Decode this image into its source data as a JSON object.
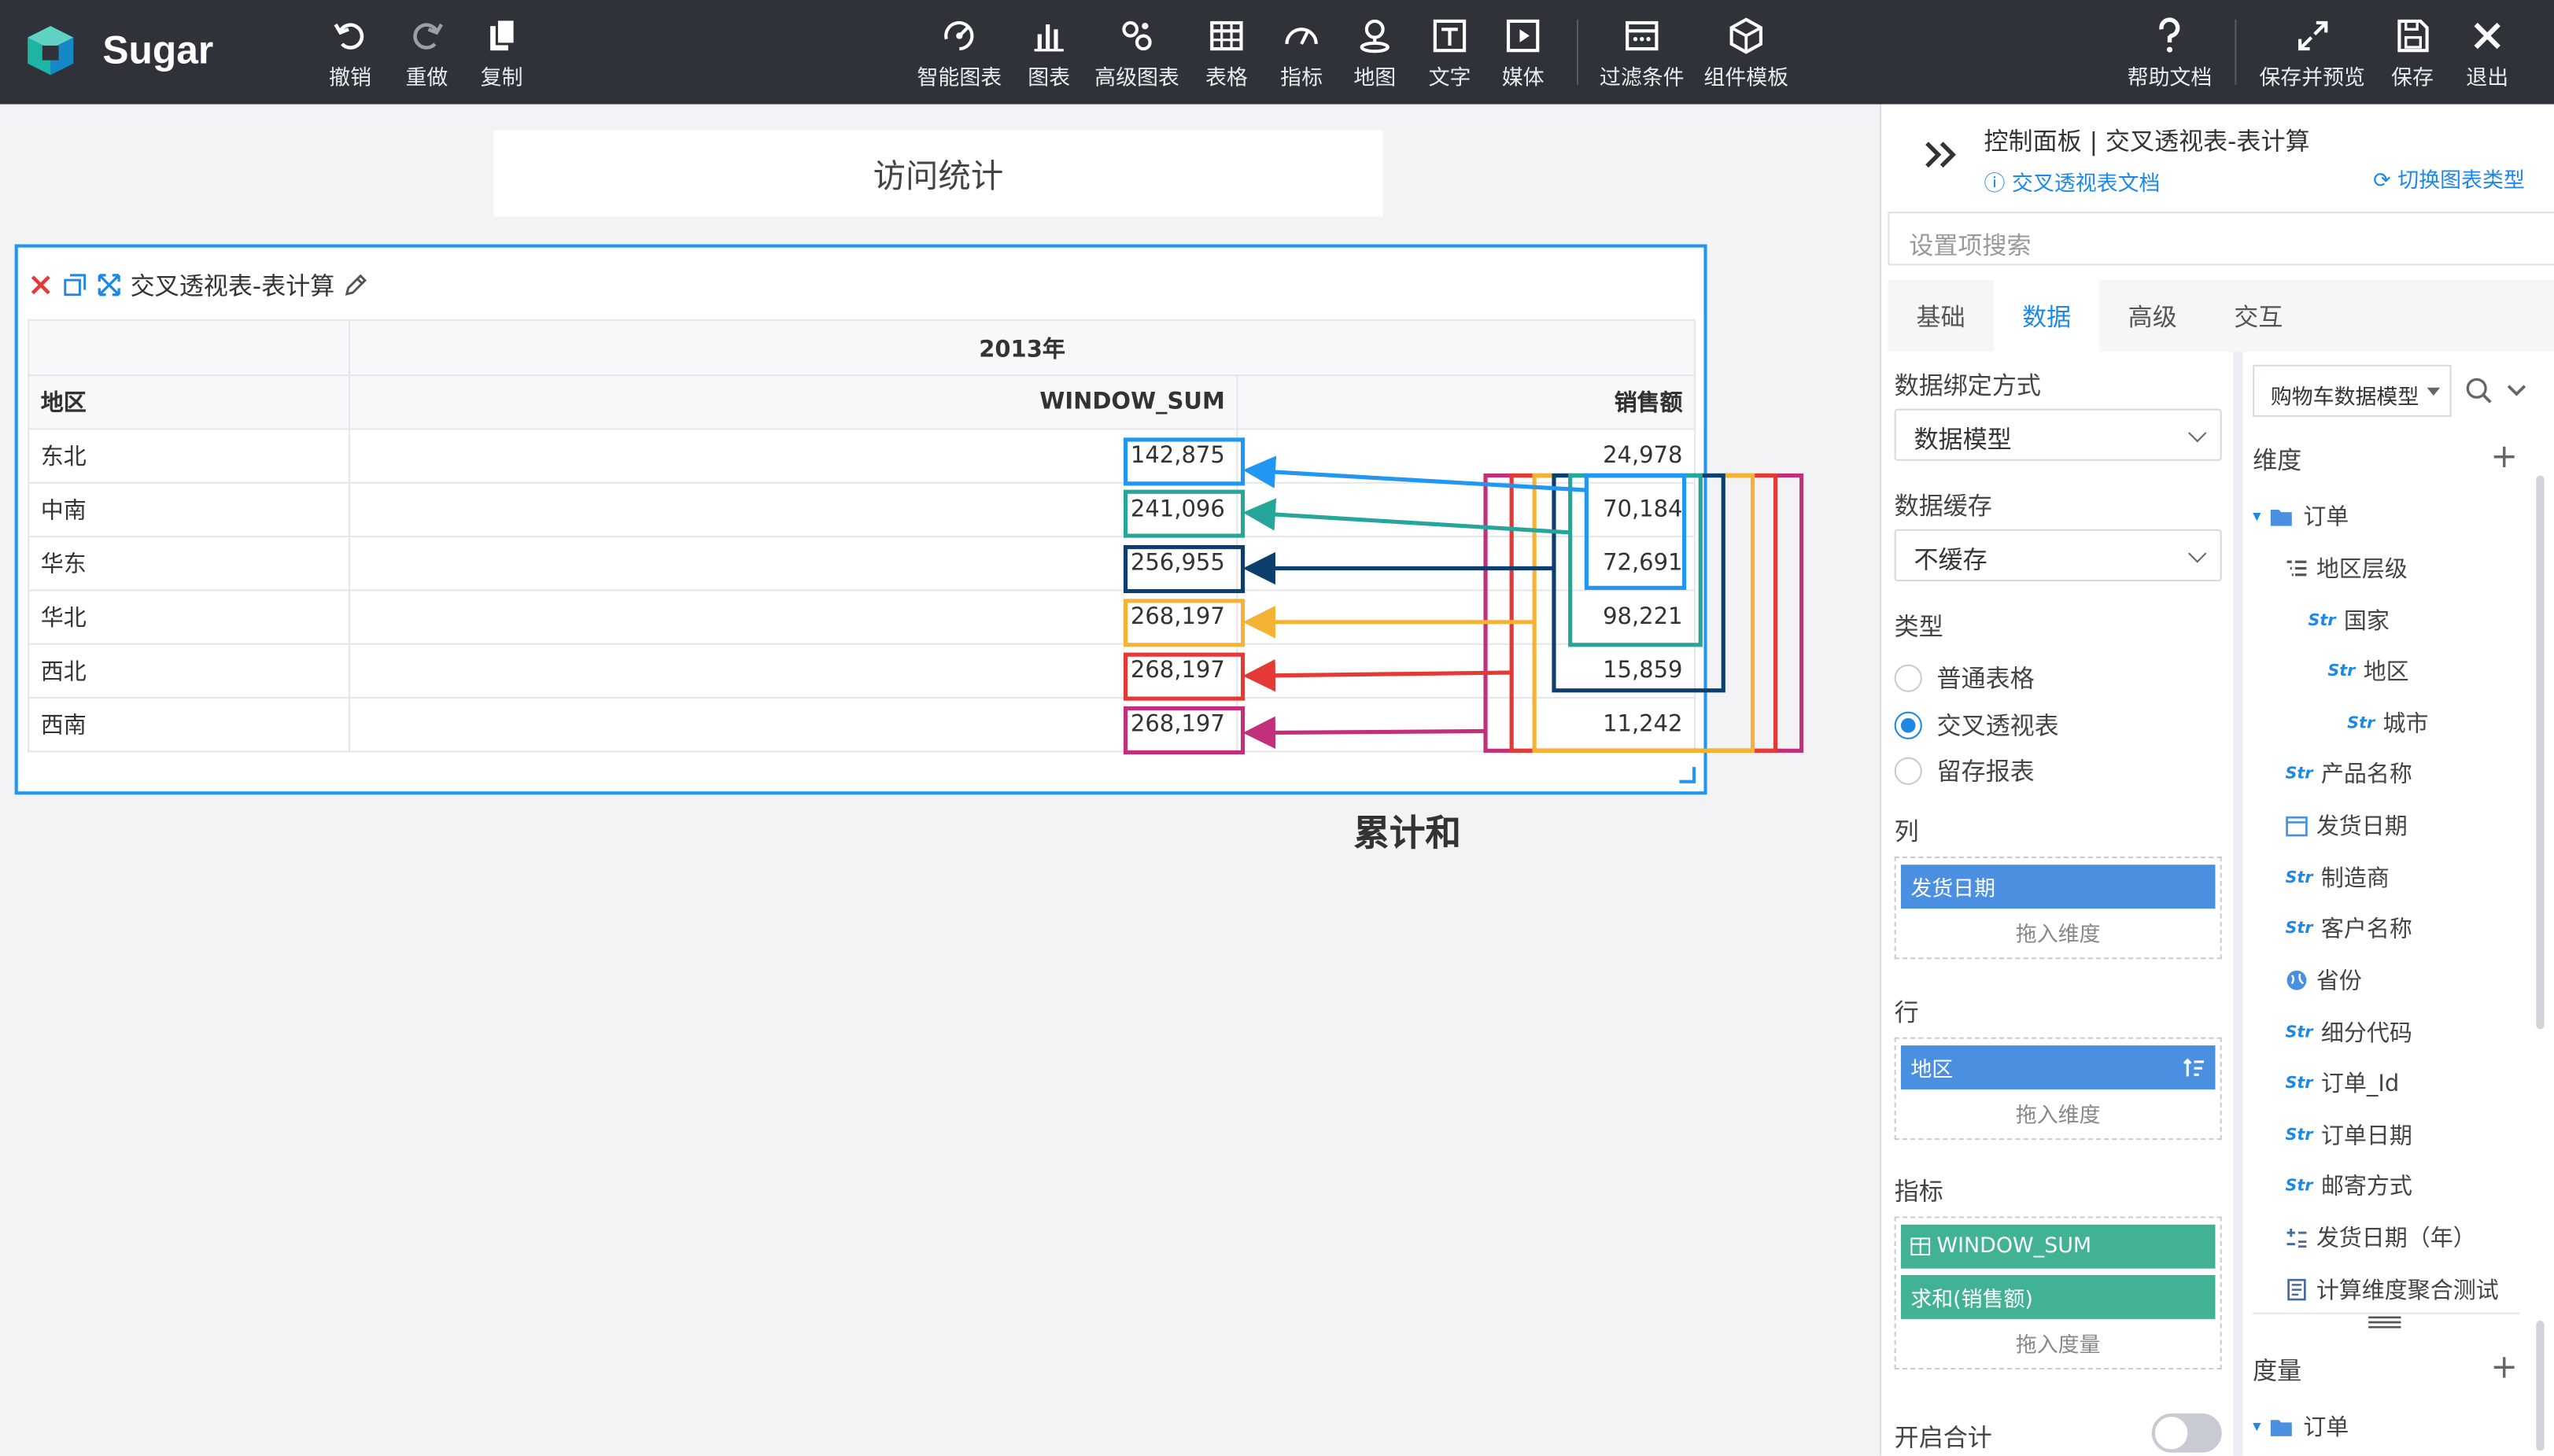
{
  "app": {
    "name": "Sugar"
  },
  "toolbar": {
    "left": [
      {
        "label": "撤销",
        "icon": "undo-icon"
      },
      {
        "label": "重做",
        "icon": "redo-icon"
      },
      {
        "label": "复制",
        "icon": "copy-icon"
      }
    ],
    "center": [
      {
        "label": "智能图表",
        "icon": "smart-chart-icon"
      },
      {
        "label": "图表",
        "icon": "bar-chart-icon"
      },
      {
        "label": "高级图表",
        "icon": "advanced-chart-icon"
      },
      {
        "label": "表格",
        "icon": "table-icon"
      },
      {
        "label": "指标",
        "icon": "gauge-icon"
      },
      {
        "label": "地图",
        "icon": "map-pin-icon"
      },
      {
        "label": "文字",
        "icon": "text-icon"
      },
      {
        "label": "媒体",
        "icon": "media-icon"
      },
      {
        "label": "过滤条件",
        "icon": "filter-icon"
      },
      {
        "label": "组件模板",
        "icon": "template-icon"
      }
    ],
    "right": [
      {
        "label": "帮助文档",
        "icon": "help-icon"
      },
      {
        "label": "保存并预览",
        "icon": "expand-icon"
      },
      {
        "label": "保存",
        "icon": "save-icon"
      },
      {
        "label": "退出",
        "icon": "close-icon"
      }
    ]
  },
  "canvas": {
    "page_title": "访问统计",
    "widget": {
      "title": "交叉透视表-表计算",
      "column_group": "2013年",
      "row_header": "地区",
      "col_headers": [
        "WINDOW_SUM",
        "销售额"
      ],
      "rows": [
        {
          "region": "东北",
          "window_sum": "142,875",
          "sales": "24,978"
        },
        {
          "region": "中南",
          "window_sum": "241,096",
          "sales": "70,184"
        },
        {
          "region": "华东",
          "window_sum": "256,955",
          "sales": "72,691"
        },
        {
          "region": "华北",
          "window_sum": "268,197",
          "sales": "98,221"
        },
        {
          "region": "西北",
          "window_sum": "268,197",
          "sales": "15,859"
        },
        {
          "region": "西南",
          "window_sum": "268,197",
          "sales": "11,242"
        }
      ]
    },
    "annotation": {
      "label": "累计和",
      "colors": [
        "#2196f3",
        "#26a69a",
        "#0d3f6e",
        "#f5b335",
        "#e53935",
        "#c2307a"
      ]
    }
  },
  "panel": {
    "title": "控制面板 | 交叉透视表-表计算",
    "doc_link": "交叉透视表文档",
    "switch_link": "切换图表类型",
    "search_placeholder": "设置项搜索",
    "tabs": [
      "基础",
      "数据",
      "高级",
      "交互"
    ],
    "active_tab": "数据",
    "binding_label": "数据绑定方式",
    "binding_value": "数据模型",
    "cache_label": "数据缓存",
    "cache_value": "不缓存",
    "type_label": "类型",
    "types": [
      "普通表格",
      "交叉透视表",
      "留存报表"
    ],
    "selected_type": "交叉透视表",
    "columns_label": "列",
    "columns_chip": "发货日期",
    "rows_label": "行",
    "rows_chip": "地区",
    "metrics_label": "指标",
    "metric_chips": [
      "WINDOW_SUM",
      "求和(销售额)"
    ],
    "drop_dim": "拖入维度",
    "drop_measure": "拖入度量",
    "total_label": "开启合计",
    "model_select": "购物车数据模型",
    "dimension_label": "维度",
    "measure_label": "度量",
    "dimension_tree": [
      {
        "label": "订单",
        "type": "folder"
      },
      {
        "label": "地区层级",
        "type": "hierarchy"
      },
      {
        "label": "国家",
        "type": "Str"
      },
      {
        "label": "地区",
        "type": "Str"
      },
      {
        "label": "城市",
        "type": "Str"
      },
      {
        "label": "产品名称",
        "type": "Str"
      },
      {
        "label": "发货日期",
        "type": "date"
      },
      {
        "label": "制造商",
        "type": "Str"
      },
      {
        "label": "客户名称",
        "type": "Str"
      },
      {
        "label": "省份",
        "type": "geo"
      },
      {
        "label": "细分代码",
        "type": "Str"
      },
      {
        "label": "订单_Id",
        "type": "Str"
      },
      {
        "label": "订单日期",
        "type": "Str"
      },
      {
        "label": "邮寄方式",
        "type": "Str"
      },
      {
        "label": "发货日期（年）",
        "type": "calc"
      },
      {
        "label": "计算维度聚合测试",
        "type": "calc2"
      }
    ],
    "measure_tree": [
      {
        "label": "订单",
        "type": "folder"
      }
    ],
    "str_tag": "Str"
  }
}
